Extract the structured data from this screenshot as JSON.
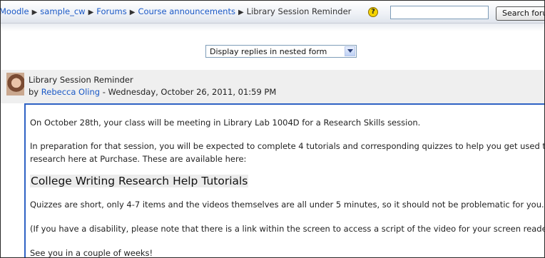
{
  "navbar": {
    "breadcrumbs": [
      "Moodle",
      "sample_cw",
      "Forums",
      "Course announcements"
    ],
    "current": "Library Session Reminder",
    "help_glyph": "?",
    "search_value": "",
    "search_button": "Search forums"
  },
  "display_mode": {
    "selected": "Display replies in nested form"
  },
  "post": {
    "subject": "Library Session Reminder",
    "by": "by",
    "author": "Rebecca Oling",
    "date": " - Wednesday, October 26, 2011, 01:59 PM",
    "paragraphs": [
      "On October 28th, your class will be meeting in Library Lab 1004D for a Research Skills session.",
      "In preparation for that session, you will be expected to complete 4 tutorials and corresponding quizzes to help you get used to",
      "research here at Purchase. These are available here:",
      "College Writing Research Help Tutorials",
      "Quizzes are short, only 4-7 items and the videos themselves are all under 5 minutes, so it should not be problematic for you.",
      "(If you have a disability, please note that there is a link within the screen to access a script of the video for your screen reader)",
      "See you in a couple of weeks!"
    ]
  }
}
